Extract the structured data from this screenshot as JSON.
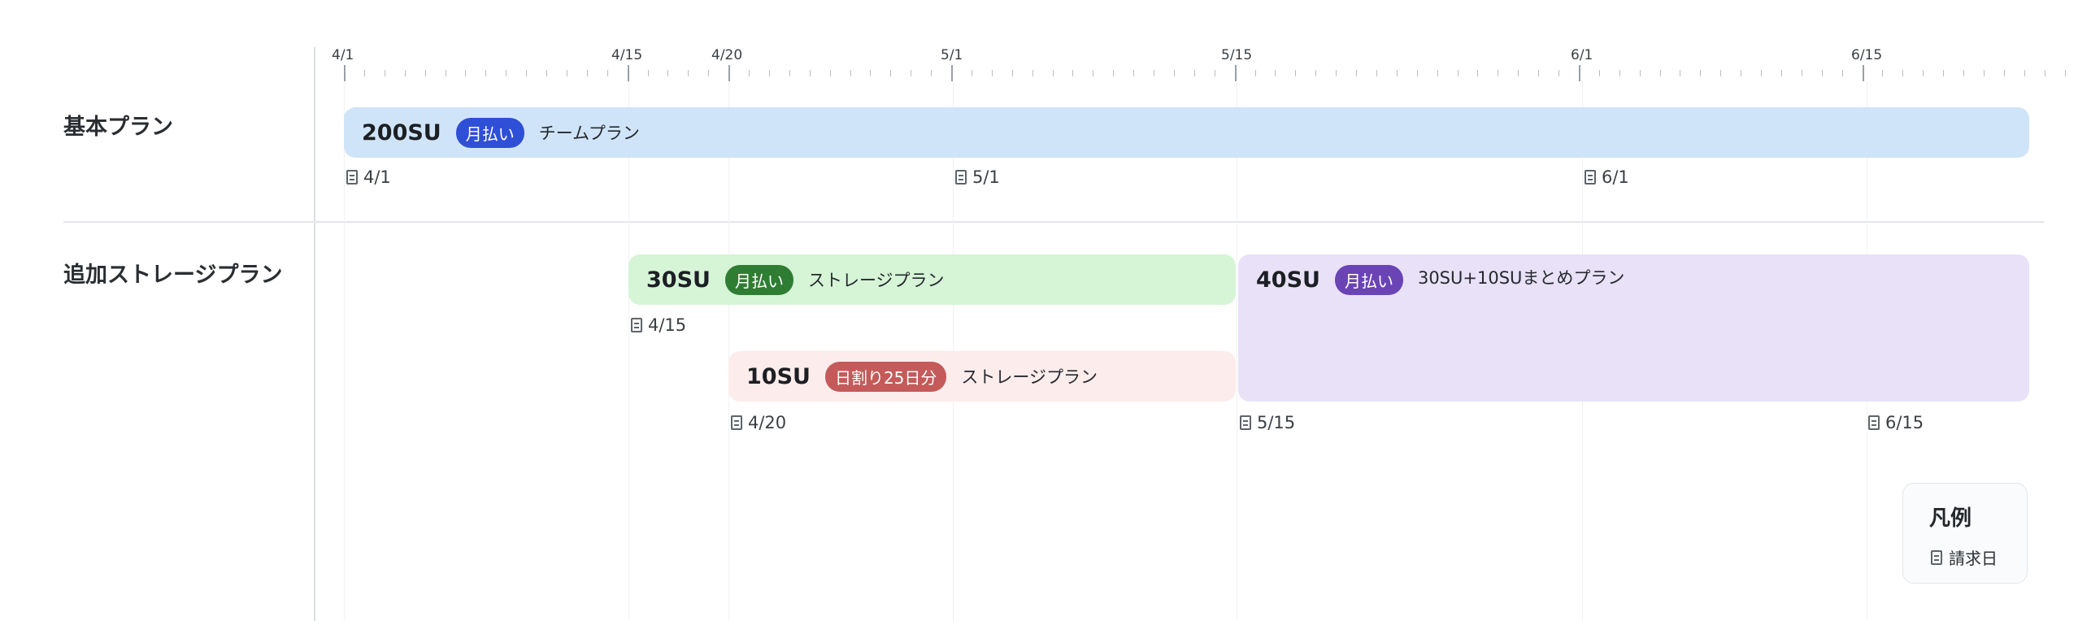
{
  "rows": {
    "basic_label": "基本プラン",
    "storage_label": "追加ストレージプラン"
  },
  "axis": {
    "labels": [
      "4/1",
      "4/15",
      "4/20",
      "5/1",
      "5/15",
      "6/1",
      "6/15"
    ]
  },
  "bars": {
    "basic": {
      "amount": "200SU",
      "badge": "月払い",
      "name": "チームプラン",
      "color": "#cfe4f8",
      "badge_color": "#2f4fd6"
    },
    "storage30": {
      "amount": "30SU",
      "badge": "月払い",
      "name": "ストレージプラン",
      "color": "#d6f4d6",
      "badge_color": "#2f7d33"
    },
    "storage10": {
      "amount": "10SU",
      "badge": "日割り25日分",
      "name": "ストレージプラン",
      "color": "#fdecec",
      "badge_color": "#c45a5a"
    },
    "storage40": {
      "amount": "40SU",
      "badge": "月払い",
      "name": "30SU+10SUまとめプラン",
      "color": "#e8e1f8",
      "badge_color": "#6a44b5"
    }
  },
  "billing": {
    "basic": [
      "4/1",
      "5/1",
      "6/1"
    ],
    "storage": [
      "4/15",
      "4/20",
      "5/15",
      "6/15"
    ]
  },
  "legend": {
    "title": "凡例",
    "billing_day": "請求日",
    "icon": "receipt-icon"
  }
}
